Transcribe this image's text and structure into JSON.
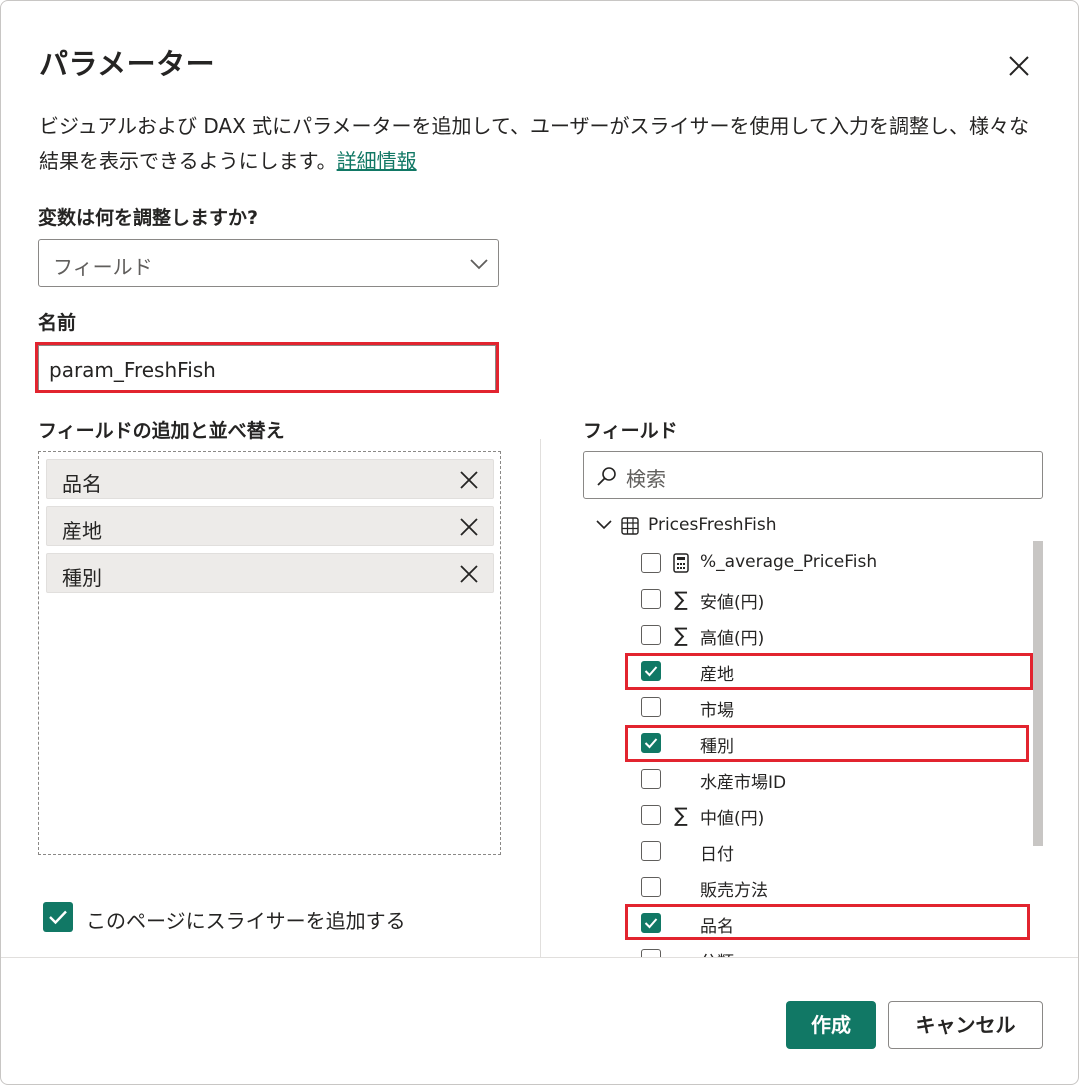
{
  "dialog": {
    "title": "パラメーター",
    "description_text": "ビジュアルおよび DAX 式にパラメーターを追加して、ユーザーがスライサーを使用して入力を調整し、様々な結果を表示できるようにします。",
    "learn_more_link": "詳細情報"
  },
  "variable": {
    "label": "変数は何を調整しますか?",
    "selected": "フィールド"
  },
  "name": {
    "label": "名前",
    "value": "param_FreshFish"
  },
  "order": {
    "label": "フィールドの追加と並べ替え",
    "items": [
      {
        "label": "品名"
      },
      {
        "label": "産地"
      },
      {
        "label": "種別"
      }
    ]
  },
  "fields": {
    "label": "フィールド",
    "search_placeholder": "検索",
    "table": "PricesFreshFish",
    "items": [
      {
        "label": "%_average_PriceFish",
        "icon": "calculator-icon",
        "checked": false
      },
      {
        "label": "安値(円)",
        "icon": "sigma-icon",
        "checked": false
      },
      {
        "label": "高値(円)",
        "icon": "sigma-icon",
        "checked": false
      },
      {
        "label": "産地",
        "icon": "",
        "checked": true
      },
      {
        "label": "市場",
        "icon": "",
        "checked": false
      },
      {
        "label": "種別",
        "icon": "",
        "checked": true
      },
      {
        "label": "水産市場ID",
        "icon": "",
        "checked": false
      },
      {
        "label": "中値(円)",
        "icon": "sigma-icon",
        "checked": false
      },
      {
        "label": "日付",
        "icon": "",
        "checked": false
      },
      {
        "label": "販売方法",
        "icon": "",
        "checked": false
      },
      {
        "label": "品名",
        "icon": "",
        "checked": true
      },
      {
        "label": "分類",
        "icon": "",
        "checked": false
      }
    ]
  },
  "slicer": {
    "label": "このページにスライサーを追加する",
    "checked": true
  },
  "buttons": {
    "create": "作成",
    "cancel": "キャンセル"
  },
  "colors": {
    "accent": "#117865",
    "highlight": "#e2242f"
  }
}
